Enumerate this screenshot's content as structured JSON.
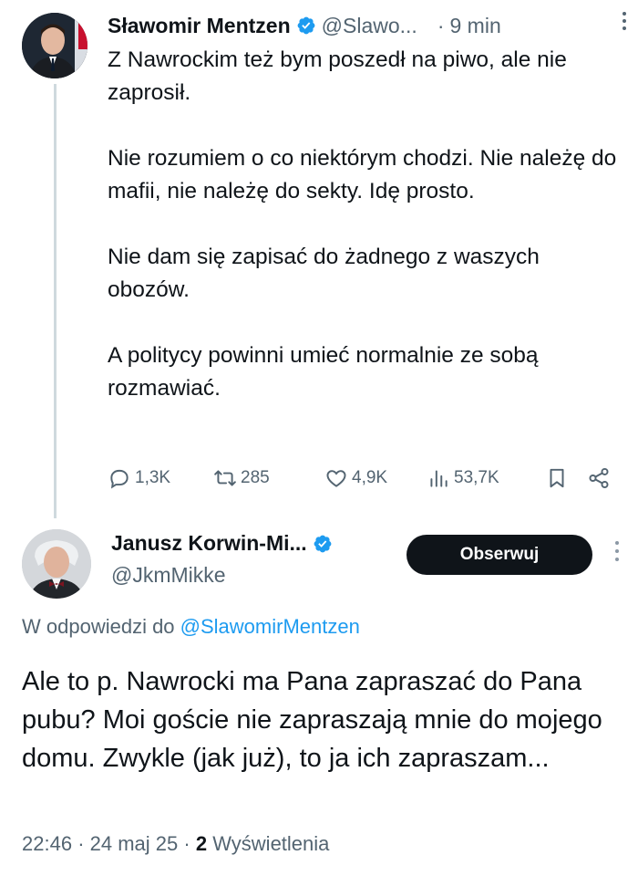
{
  "colors": {
    "accent": "#1d9bf0",
    "text": "#0f1419",
    "muted": "#536471",
    "verified_badge": "#1d9bf0",
    "follow_button_bg": "#0f1419"
  },
  "tweet1": {
    "author_name": "Sławomir Mentzen",
    "handle": "@Slawo...",
    "separator": "·",
    "time": "9 min",
    "more_icon": "more-horizontal-icon",
    "paragraphs": [
      "Z Nawrockim też bym poszedł na piwo, ale nie zaprosił.",
      "Nie rozumiem o co niektórym chodzi. Nie należę do mafii, nie należę do sekty. Idę prosto.",
      "Nie dam się zapisać do żadnego z waszych obozów.",
      "A politycy powinni umieć normalnie ze sobą rozmawiać."
    ],
    "actions": {
      "replies": "1,3K",
      "retweets": "285",
      "likes": "4,9K",
      "views": "53,7K"
    }
  },
  "tweet2": {
    "author_name": "Janusz Korwin-Mi...",
    "handle": "@JkmMikke",
    "follow_label": "Obserwuj",
    "reply_prefix": "W odpowiedzi do ",
    "reply_mention": "@SlawomirMentzen",
    "text": "Ale to p. Nawrocki ma Pana zapraszać do Pana pubu? Moi goście nie zapraszają mnie do mojego domu. Zwykle (jak już), to ja ich zapraszam...",
    "time": "22:46",
    "date": "24 maj 25",
    "separator": "·",
    "views_count": "2",
    "views_label": "Wyświetlenia"
  }
}
